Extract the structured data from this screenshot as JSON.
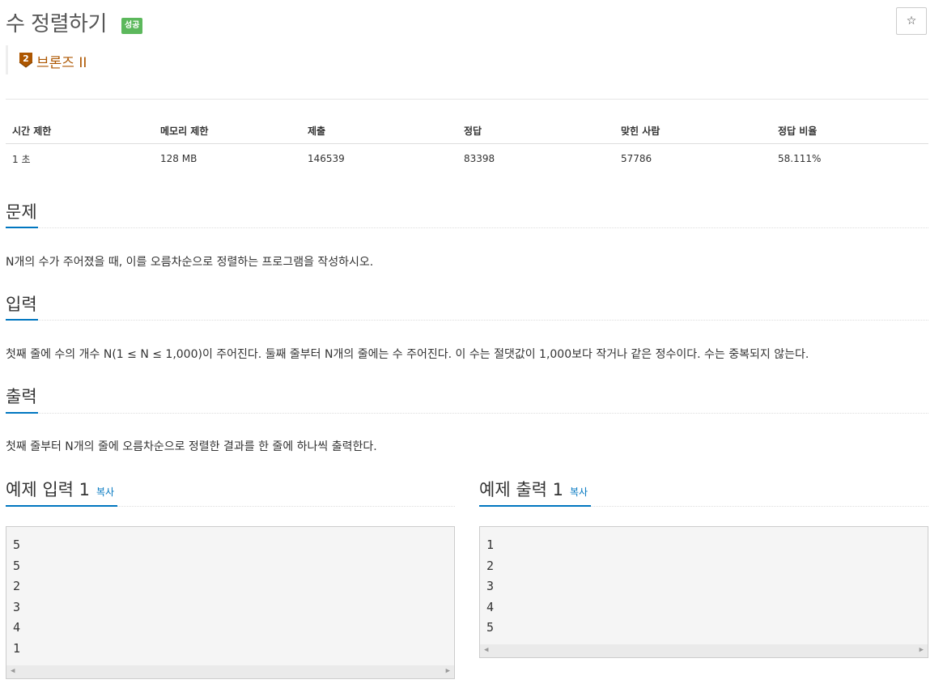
{
  "header": {
    "title": "수 정렬하기",
    "status_badge": "성공",
    "star": "☆",
    "tier_number": "2",
    "tier_label": "브론즈 II"
  },
  "info_table": {
    "headers": [
      "시간 제한",
      "메모리 제한",
      "제출",
      "정답",
      "맞힌 사람",
      "정답 비율"
    ],
    "values": [
      "1 초",
      "128 MB",
      "146539",
      "83398",
      "57786",
      "58.111%"
    ]
  },
  "problem": {
    "title": "문제",
    "text": "N개의 수가 주어졌을 때, 이를 오름차순으로 정렬하는 프로그램을 작성하시오."
  },
  "input": {
    "title": "입력",
    "text": "첫째 줄에 수의 개수 N(1 ≤ N ≤ 1,000)이 주어진다. 둘째 줄부터 N개의 줄에는 수 주어진다. 이 수는 절댓값이 1,000보다 작거나 같은 정수이다. 수는 중복되지 않는다."
  },
  "output": {
    "title": "출력",
    "text": "첫째 줄부터 N개의 줄에 오름차순으로 정렬한 결과를 한 줄에 하나씩 출력한다."
  },
  "sample_input": {
    "title": "예제 입력 1",
    "copy": "복사",
    "lines": [
      "5",
      "5",
      "2",
      "3",
      "4",
      "1"
    ]
  },
  "sample_output": {
    "title": "예제 출력 1",
    "copy": "복사",
    "lines": [
      "1",
      "2",
      "3",
      "4",
      "5"
    ]
  },
  "colors": {
    "accent": "#0076c0",
    "success": "#5cb85c",
    "bronze": "#ad5600"
  },
  "icons": [
    "star-icon",
    "bronze-tier-icon",
    "scroll-left-icon",
    "scroll-right-icon"
  ]
}
